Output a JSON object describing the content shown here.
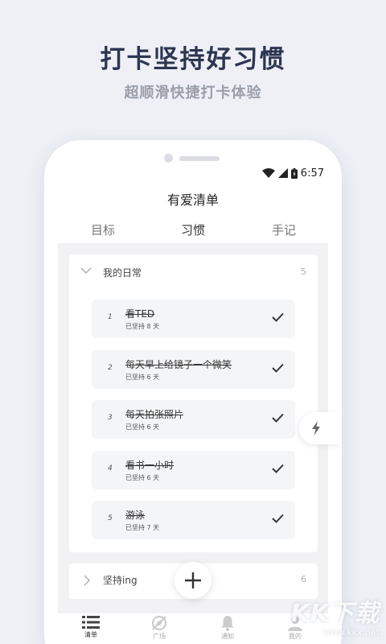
{
  "promo": {
    "headline": "打卡坚持好习惯",
    "subline": "超顺滑快捷打卡体验"
  },
  "status_bar": {
    "time": "6:57",
    "icons": [
      "wifi-icon",
      "signal-icon",
      "battery-icon"
    ]
  },
  "app": {
    "title": "有爱清单"
  },
  "tabs": [
    {
      "label": "目标",
      "active": false
    },
    {
      "label": "习惯",
      "active": true
    },
    {
      "label": "手记",
      "active": false
    }
  ],
  "groups": [
    {
      "name": "我的日常",
      "count": "5",
      "expanded": true,
      "habits": [
        {
          "index": "1",
          "name": "看TED",
          "streak": "已坚持 8 天",
          "done": true
        },
        {
          "index": "2",
          "name": "每天早上给镜子一个微笑",
          "streak": "已坚持 6 天",
          "done": true
        },
        {
          "index": "3",
          "name": "每天拍张照片",
          "streak": "已坚持 6 天",
          "done": true
        },
        {
          "index": "4",
          "name": "看书一小时",
          "streak": "已坚持 6 天",
          "done": true
        },
        {
          "index": "5",
          "name": "游泳",
          "streak": "已坚持 7 天",
          "done": true
        }
      ]
    },
    {
      "name": "坚持ing",
      "count": "6",
      "expanded": false
    }
  ],
  "bottom_nav": [
    {
      "label": "清单",
      "icon": "list-icon",
      "active": true
    },
    {
      "label": "广场",
      "icon": "compass-icon",
      "active": false
    },
    {
      "label": "通知",
      "icon": "bell-icon",
      "active": false
    },
    {
      "label": "我的",
      "icon": "user-icon",
      "active": false
    }
  ],
  "watermark": {
    "brand": "KK下载",
    "url": "www.kkx.net"
  },
  "colors": {
    "background": "#eef0f6",
    "headline": "#2d3550",
    "subline": "#9a9ea9",
    "content_bg": "#f2f2f4",
    "habit_bg": "#f4f5f7"
  }
}
